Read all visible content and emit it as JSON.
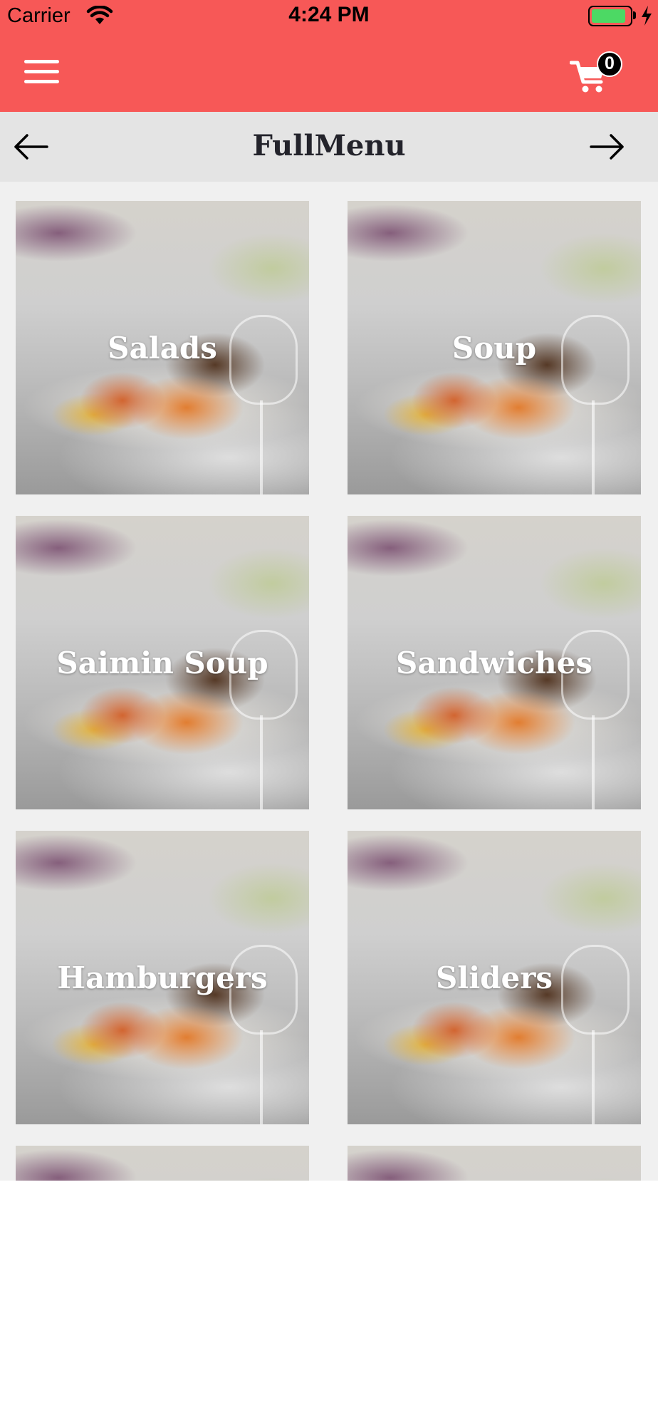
{
  "status_bar": {
    "carrier": "Carrier",
    "time": "4:24 PM",
    "battery_level": 0.92,
    "battery_color": "#4cd964",
    "wifi_icon": "wifi-icon",
    "charging_icon": "bolt-icon"
  },
  "header": {
    "background_color": "#f75857",
    "menu_icon": "hamburger-menu-icon",
    "cart_icon": "shopping-cart-icon",
    "cart_count": "0"
  },
  "nav": {
    "title": "FullMenu",
    "prev_icon": "arrow-left-icon",
    "next_icon": "arrow-right-icon"
  },
  "categories": [
    {
      "label": "Salads"
    },
    {
      "label": "Soup"
    },
    {
      "label": "Saimin Soup"
    },
    {
      "label": "Sandwiches"
    },
    {
      "label": "Hamburgers"
    },
    {
      "label": "Sliders"
    },
    {
      "label": ""
    },
    {
      "label": ""
    }
  ]
}
